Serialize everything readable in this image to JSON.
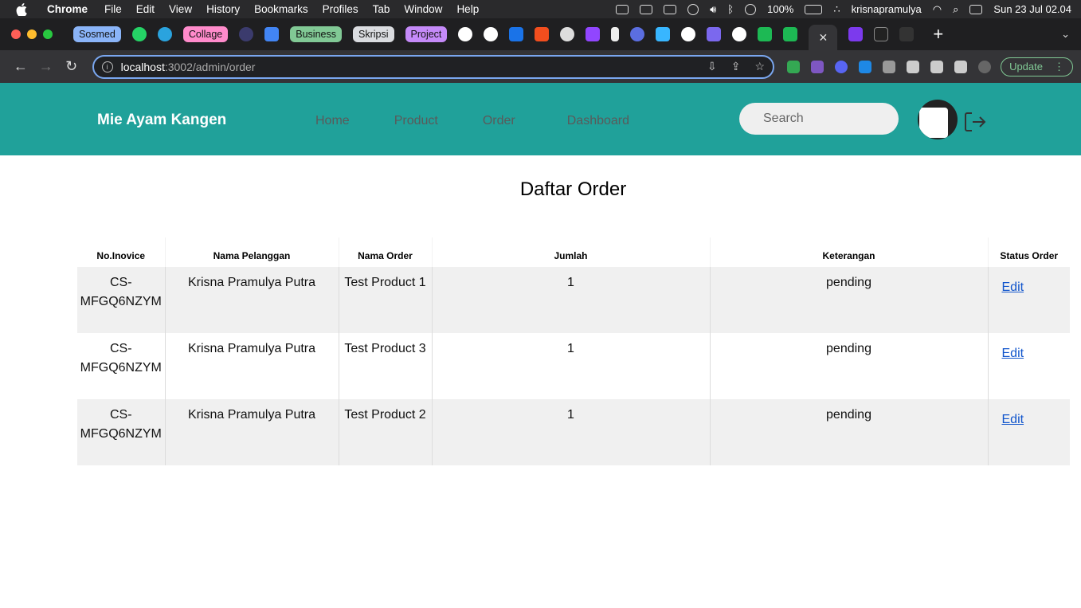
{
  "system": {
    "app_name": "Chrome",
    "menus": [
      "File",
      "Edit",
      "View",
      "History",
      "Bookmarks",
      "Profiles",
      "Tab",
      "Window",
      "Help"
    ],
    "battery": "100%",
    "user": "krisnapramulya",
    "datetime": "Sun 23 Jul  02.04"
  },
  "browser": {
    "tab_groups": [
      {
        "label": "Sosmed",
        "color": "#8ab4f8"
      },
      {
        "label": "Collage",
        "color": "#ff8bcb"
      },
      {
        "label": "Business",
        "color": "#81c995"
      },
      {
        "label": "Skripsi",
        "color": "#dadce0"
      },
      {
        "label": "Project",
        "color": "#c58af9"
      }
    ],
    "url_host": "localhost",
    "url_path": ":3002/admin/order",
    "update_label": "Update"
  },
  "app": {
    "brand": "Mie Ayam Kangen",
    "nav": [
      "Home",
      "Product",
      "Order",
      "Dashboard"
    ],
    "search_placeholder": "Search",
    "page_title": "Daftar Order"
  },
  "table": {
    "headers": [
      "No.Inovice",
      "Nama Pelanggan",
      "Nama Order",
      "Jumlah",
      "Keterangan",
      "Status Order"
    ],
    "rows": [
      {
        "invoice_line1": "CS-",
        "invoice_line2": "MFGQ6NZYM",
        "customer": "Krisna Pramulya Putra",
        "product": "Test Product 1",
        "qty": "1",
        "note": "pending",
        "action": "Edit"
      },
      {
        "invoice_line1": "CS-",
        "invoice_line2": "MFGQ6NZYM",
        "customer": "Krisna Pramulya Putra",
        "product": "Test Product 3",
        "qty": "1",
        "note": "pending",
        "action": "Edit"
      },
      {
        "invoice_line1": "CS-",
        "invoice_line2": "MFGQ6NZYM",
        "customer": "Krisna Pramulya Putra",
        "product": "Test Product 2",
        "qty": "1",
        "note": "pending",
        "action": "Edit"
      }
    ]
  },
  "colors": {
    "nav_bg": "#20a19a",
    "link": "#1155cc"
  }
}
